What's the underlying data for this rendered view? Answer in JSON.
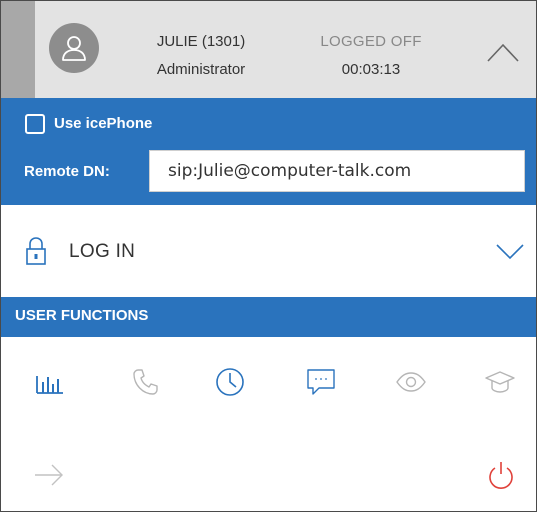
{
  "user": {
    "name": "JULIE (1301)",
    "role": "Administrator"
  },
  "status": {
    "label": "LOGGED OFF",
    "timer": "00:03:13"
  },
  "settings": {
    "use_icephone_label": "Use icePhone",
    "use_icephone_checked": false,
    "remote_dn_label": "Remote DN:",
    "remote_dn_value": "sip:Julie@computer-talk.com"
  },
  "login": {
    "label": "LOG IN"
  },
  "user_functions": {
    "title": "USER FUNCTIONS",
    "icons": [
      "bar-chart-icon",
      "phone-icon",
      "clock-icon",
      "chat-icon",
      "eye-icon",
      "graduation-cap-icon"
    ]
  },
  "bottom_actions": {
    "icons": [
      "arrow-right-icon",
      "power-icon"
    ]
  },
  "colors": {
    "header_bg": "#e3e3e3",
    "accent_blue": "#2a73bd",
    "power_red": "#e0413a",
    "muted_gray": "#b5b5b5"
  }
}
